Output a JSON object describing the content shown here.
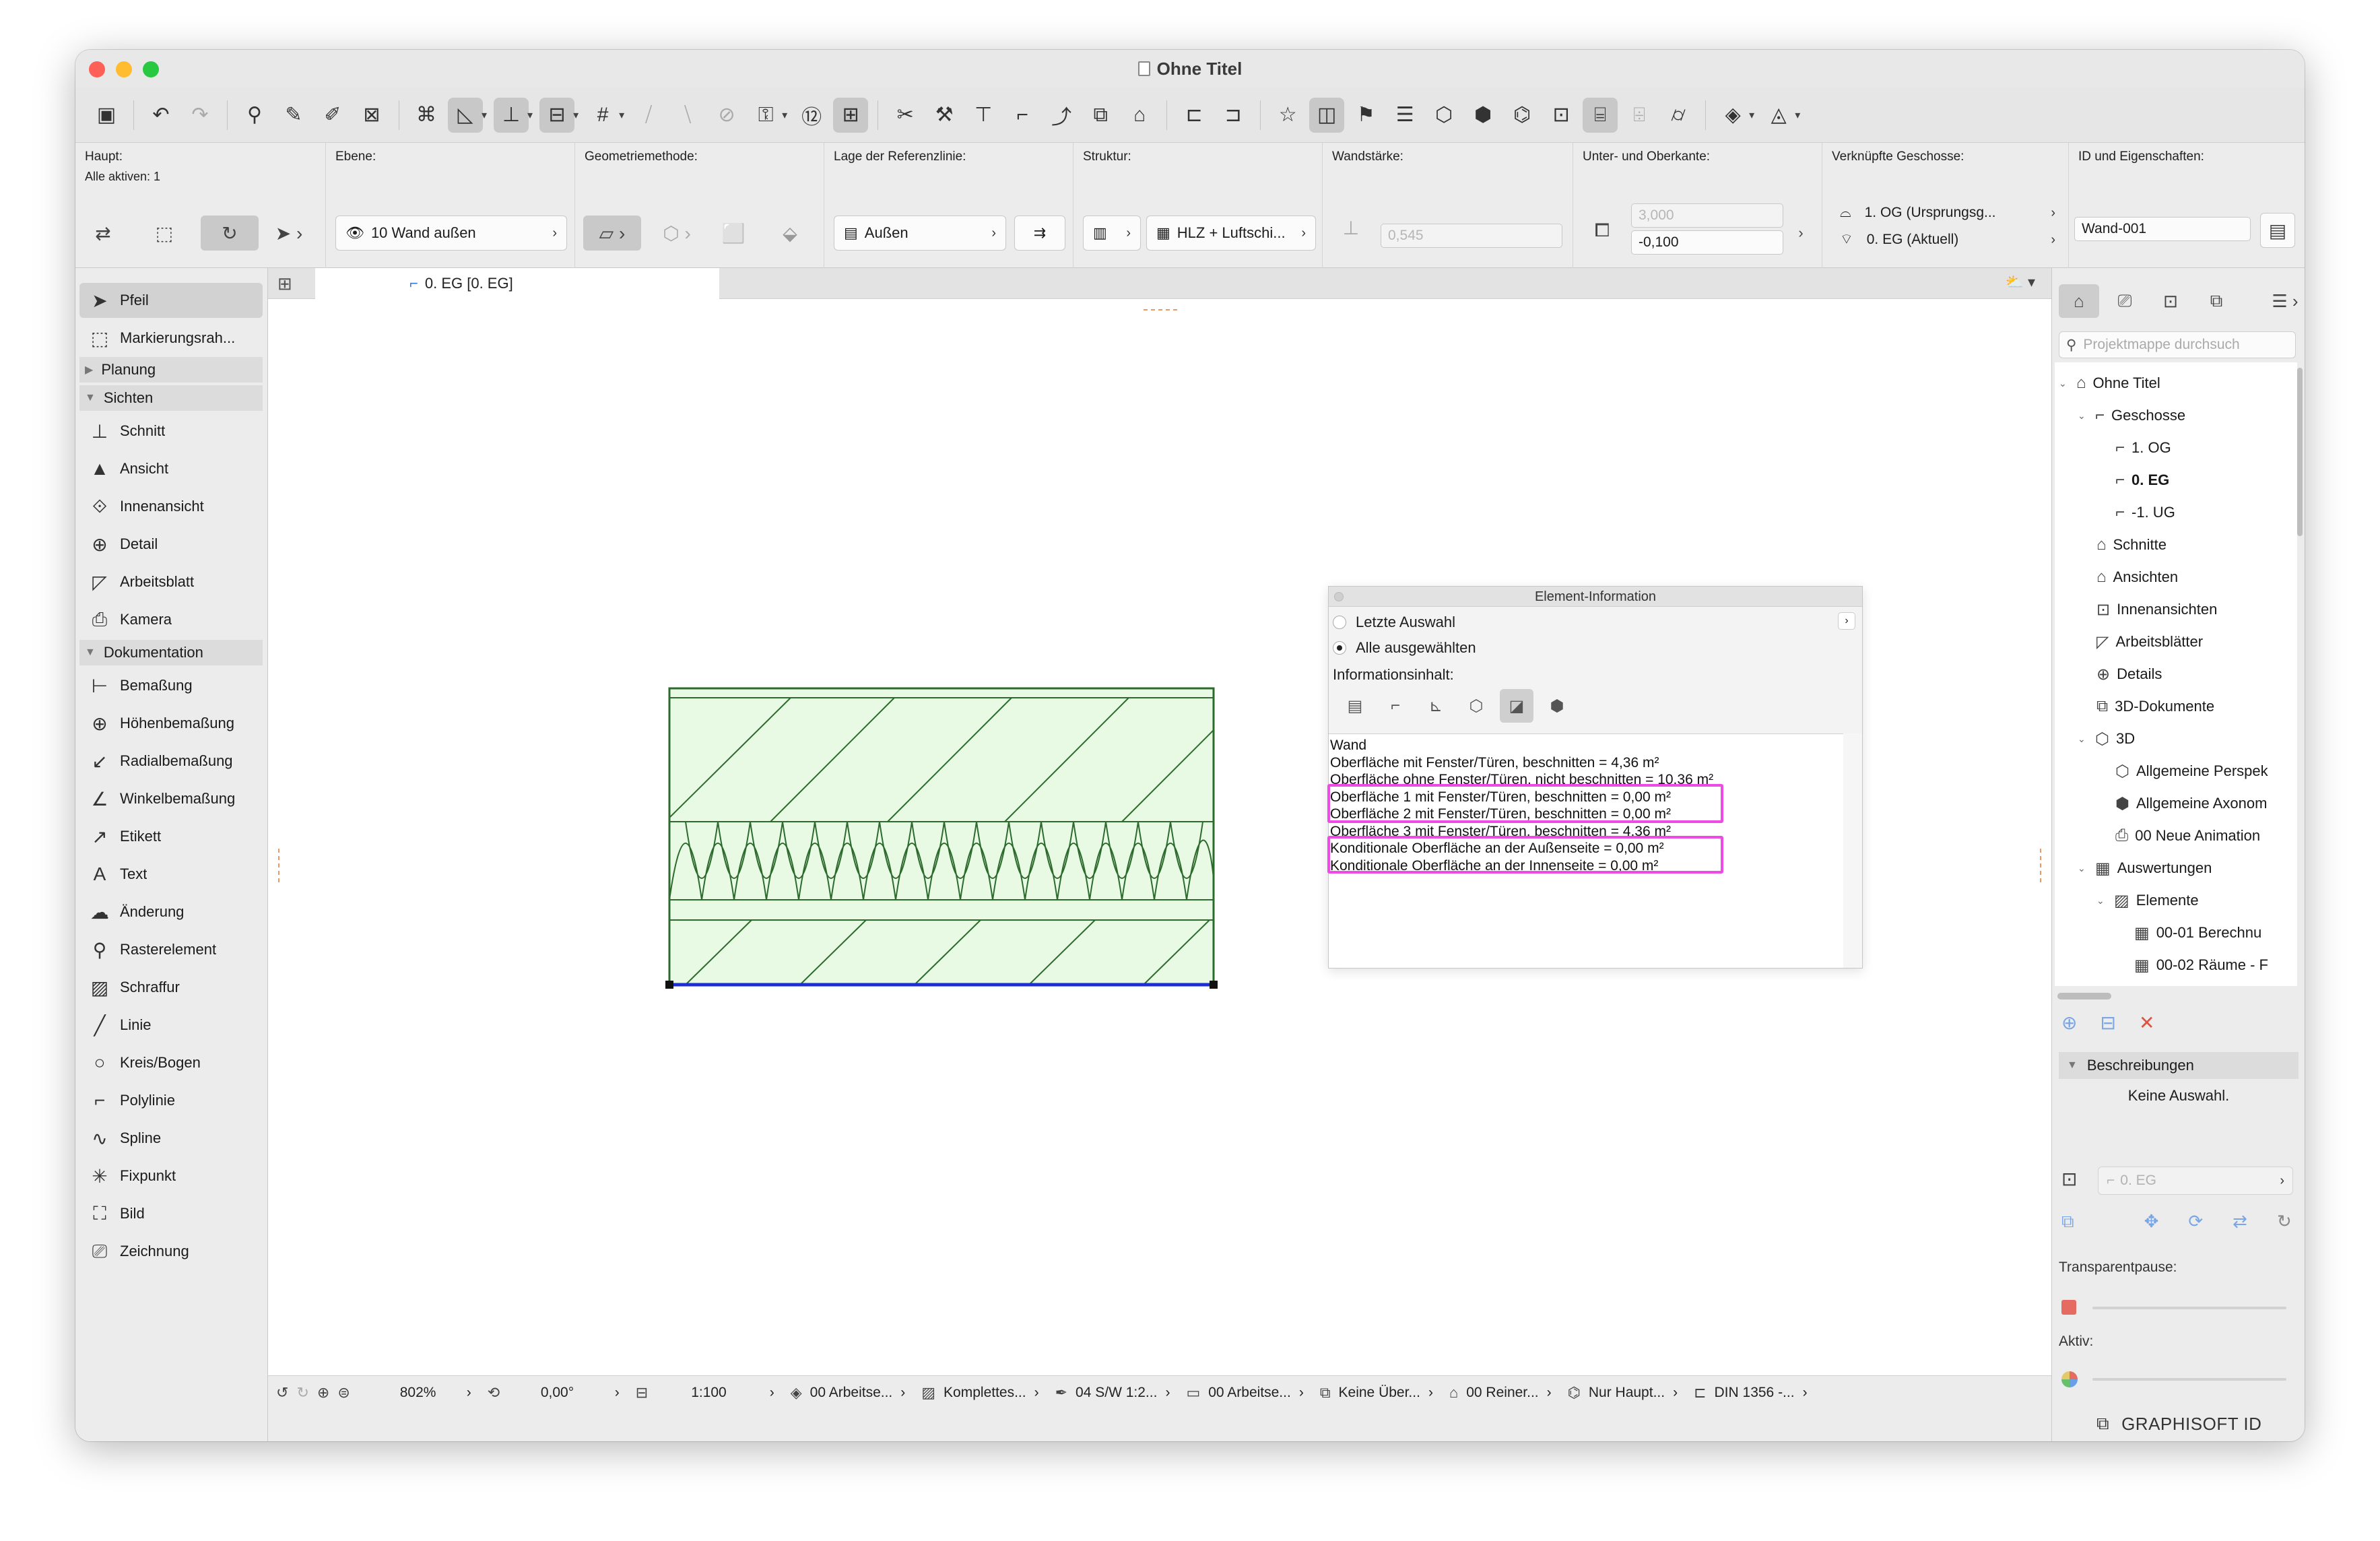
{
  "window": {
    "title": "Ohne Titel",
    "colors": {
      "close": "#fe5f57",
      "minimize": "#febc2e",
      "maximize": "#28c840",
      "highlight": "#ee4ae6"
    }
  },
  "infobox": {
    "main_label": "Haupt:",
    "all_active": "Alle aktiven: 1",
    "layer_label": "Ebene:",
    "layer_value": "10 Wand außen",
    "geometry_label": "Geometriemethode:",
    "refline_label": "Lage der Referenzlinie:",
    "refline_value": "Außen",
    "structure_label": "Struktur:",
    "structure_value": "HLZ + Luftschi...",
    "thickness_label": "Wandstärke:",
    "thickness_value": "0,545",
    "topbottom_label": "Unter- und Oberkante:",
    "top_value": "3,000",
    "bottom_value": "-0,100",
    "linked_label": "Verknüpfte Geschosse:",
    "linked_top": "1. OG (Ursprungsg...",
    "linked_bottom": "0. EG (Aktuell)",
    "id_label": "ID und Eigenschaften:",
    "id_value": "Wand-001"
  },
  "toolbox": {
    "arrow": "Pfeil",
    "marquee": "Markierungsrah...",
    "sect_planning": "Planung",
    "sect_views": "Sichten",
    "views": [
      "Schnitt",
      "Ansicht",
      "Innenansicht",
      "Detail",
      "Arbeitsblatt",
      "Kamera"
    ],
    "sect_docs": "Dokumentation",
    "docs": [
      "Bemaßung",
      "Höhenbemaßung",
      "Radialbemaßung",
      "Winkelbemaßung",
      "Etikett",
      "Text",
      "Änderung",
      "Rasterelement",
      "Schraffur",
      "Linie",
      "Kreis/Bogen",
      "Polylinie",
      "Spline",
      "Fixpunkt",
      "Bild",
      "Zeichnung"
    ]
  },
  "tab": {
    "label": "0. EG [0. EG]"
  },
  "element_info": {
    "title": "Element-Information",
    "last_selection": "Letzte Auswahl",
    "all_selected": "Alle ausgewählten",
    "content_label": "Informationsinhalt:",
    "lines": [
      "Wand",
      "Oberfläche mit Fenster/Türen, beschnitten = 4,36 m²",
      "Oberfläche ohne Fenster/Türen, nicht beschnitten = 10,36 m²",
      "Oberfläche 1 mit Fenster/Türen, beschnitten = 0,00 m²",
      "Oberfläche 2 mit Fenster/Türen, beschnitten = 0,00 m²",
      "Oberfläche 3 mit Fenster/Türen, beschnitten = 4,36 m²",
      "Konditionale Oberfläche an der Außenseite = 0,00 m²",
      "Konditionale Oberfläche an der Innenseite = 0,00 m²"
    ]
  },
  "navigator": {
    "search_placeholder": "Projektmappe durchsuch",
    "root": "Ohne Titel",
    "storeys": "Geschosse",
    "storey_items": [
      "1. OG",
      "0. EG",
      "-1. UG"
    ],
    "sections": "Schnitte",
    "elevations": "Ansichten",
    "interior": "Innenansichten",
    "worksheets": "Arbeitsblätter",
    "details": "Details",
    "docs3d": "3D-Dokumente",
    "three_d": "3D",
    "three_d_items": [
      "Allgemeine Perspek",
      "Allgemeine Axonom",
      "00 Neue Animation"
    ],
    "schedules": "Auswertungen",
    "elements": "Elemente",
    "element_items": [
      "00-01 Berechnu",
      "00-02 Räume - F"
    ],
    "descriptions": "Beschreibungen",
    "no_selection": "Keine Auswahl.",
    "storey_field": "0. EG",
    "transparency": "Transparentpause:",
    "active": "Aktiv:",
    "brand": "GRAPHISOFT ID"
  },
  "status": {
    "zoom": "802%",
    "angle": "0,00°",
    "scale": "1:100",
    "layer_combo": "00 Arbeitse...",
    "model_view": "Komplettes...",
    "pen_set": "04 S/W 1:2...",
    "mvo": "00 Arbeitse...",
    "overrides": "Keine Über...",
    "renovation": "00 Reiner...",
    "structure": "Nur Haupt...",
    "dimension": "DIN 1356 -..."
  }
}
